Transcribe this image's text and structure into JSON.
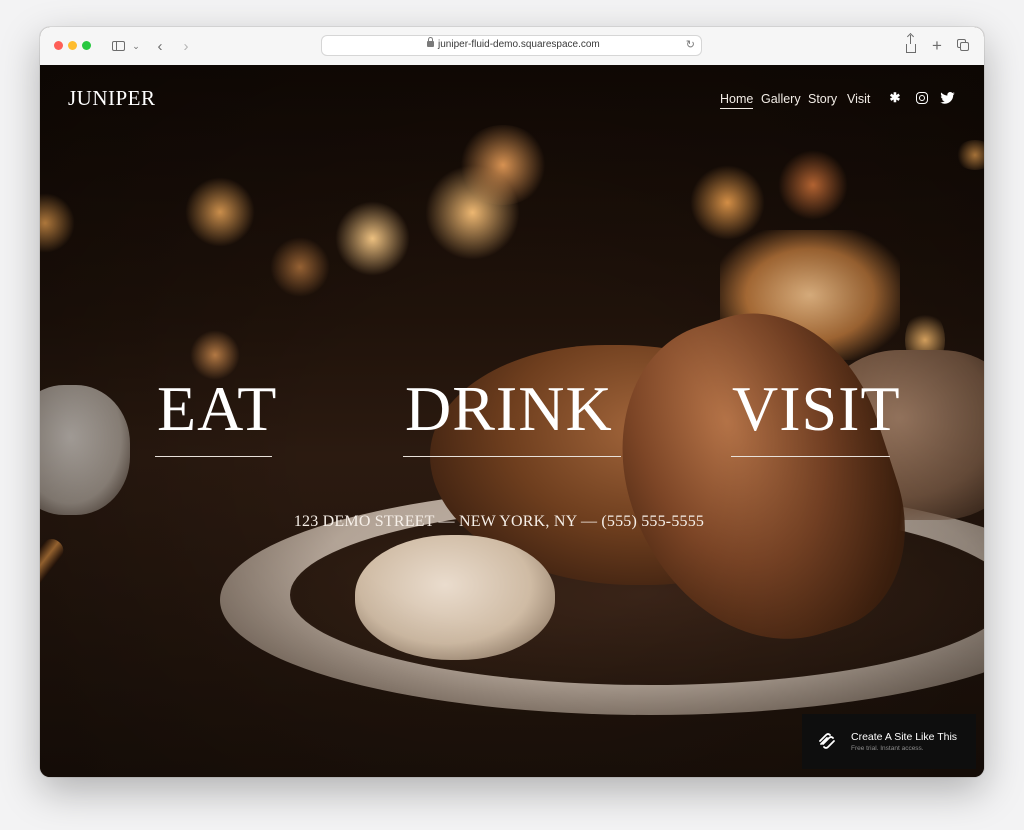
{
  "browser": {
    "url": "juniper-fluid-demo.squarespace.com"
  },
  "site": {
    "logo": "JUNIPER",
    "nav": [
      {
        "label": "Home",
        "active": true
      },
      {
        "label": "Gallery"
      },
      {
        "label": "Story"
      },
      {
        "label": "Visit"
      }
    ],
    "social_icons": [
      "yelp-icon",
      "instagram-icon",
      "twitter-icon"
    ]
  },
  "hero": {
    "links": [
      "EAT",
      "DRINK",
      "VISIT"
    ],
    "address": "123 DEMO STREET — NEW YORK, NY — (555) 555-5555"
  },
  "badge": {
    "title": "Create A Site Like This",
    "subtitle": "Free trial. Instant access."
  },
  "colors": {
    "traffic_red": "#fe5f57",
    "traffic_yellow": "#febc2e",
    "traffic_green": "#28c840",
    "badge_bg": "#0e0e0e"
  }
}
